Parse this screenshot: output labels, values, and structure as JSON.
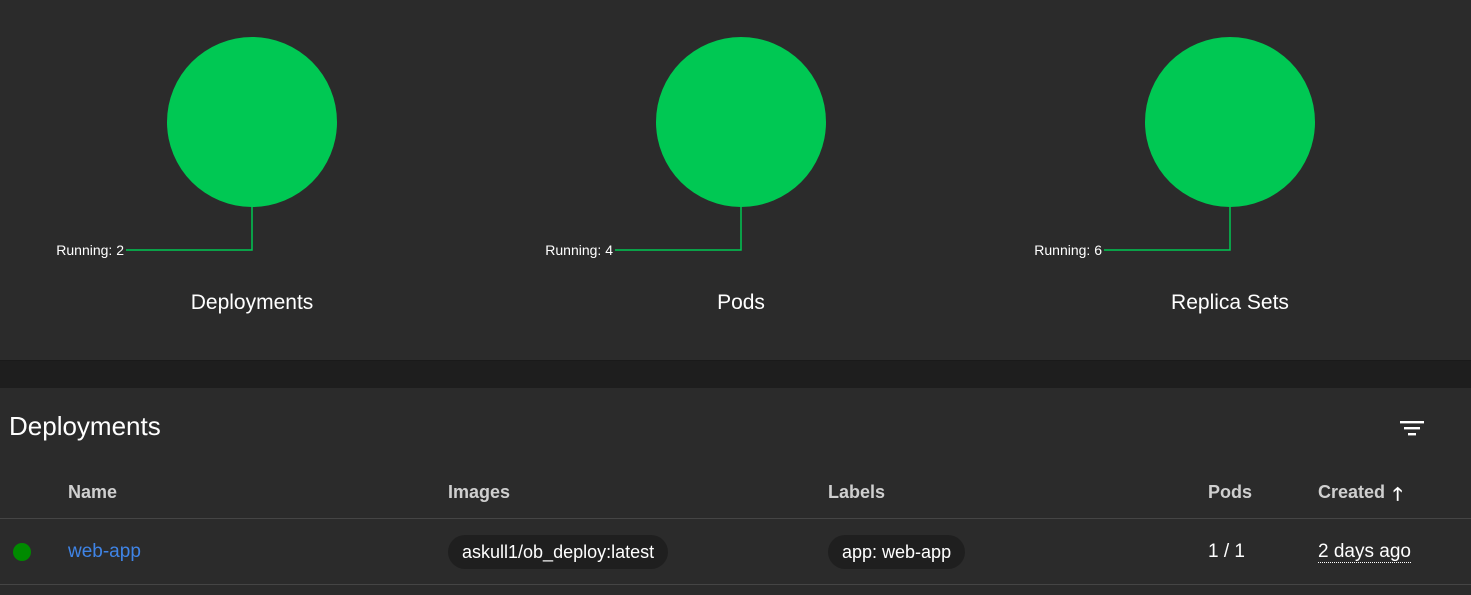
{
  "workloads": {
    "charts": [
      {
        "title": "Deployments",
        "running_label": "Running: 2",
        "running": 2,
        "color": "#00c853"
      },
      {
        "title": "Pods",
        "running_label": "Running: 4",
        "running": 4,
        "color": "#00c853"
      },
      {
        "title": "Replica Sets",
        "running_label": "Running: 6",
        "running": 6,
        "color": "#00c853"
      }
    ]
  },
  "deployments": {
    "title": "Deployments",
    "filter_icon": "filter-list-icon",
    "columns": {
      "name": "Name",
      "images": "Images",
      "labels": "Labels",
      "pods": "Pods",
      "created": "Created",
      "sort_icon": "arrow-upward-icon"
    },
    "rows": [
      {
        "status_color": "#008a00",
        "name": "web-app",
        "image": "askull1/ob_deploy:latest",
        "label": "app: web-app",
        "pods": "1 / 1",
        "created": "2 days ago"
      }
    ]
  }
}
